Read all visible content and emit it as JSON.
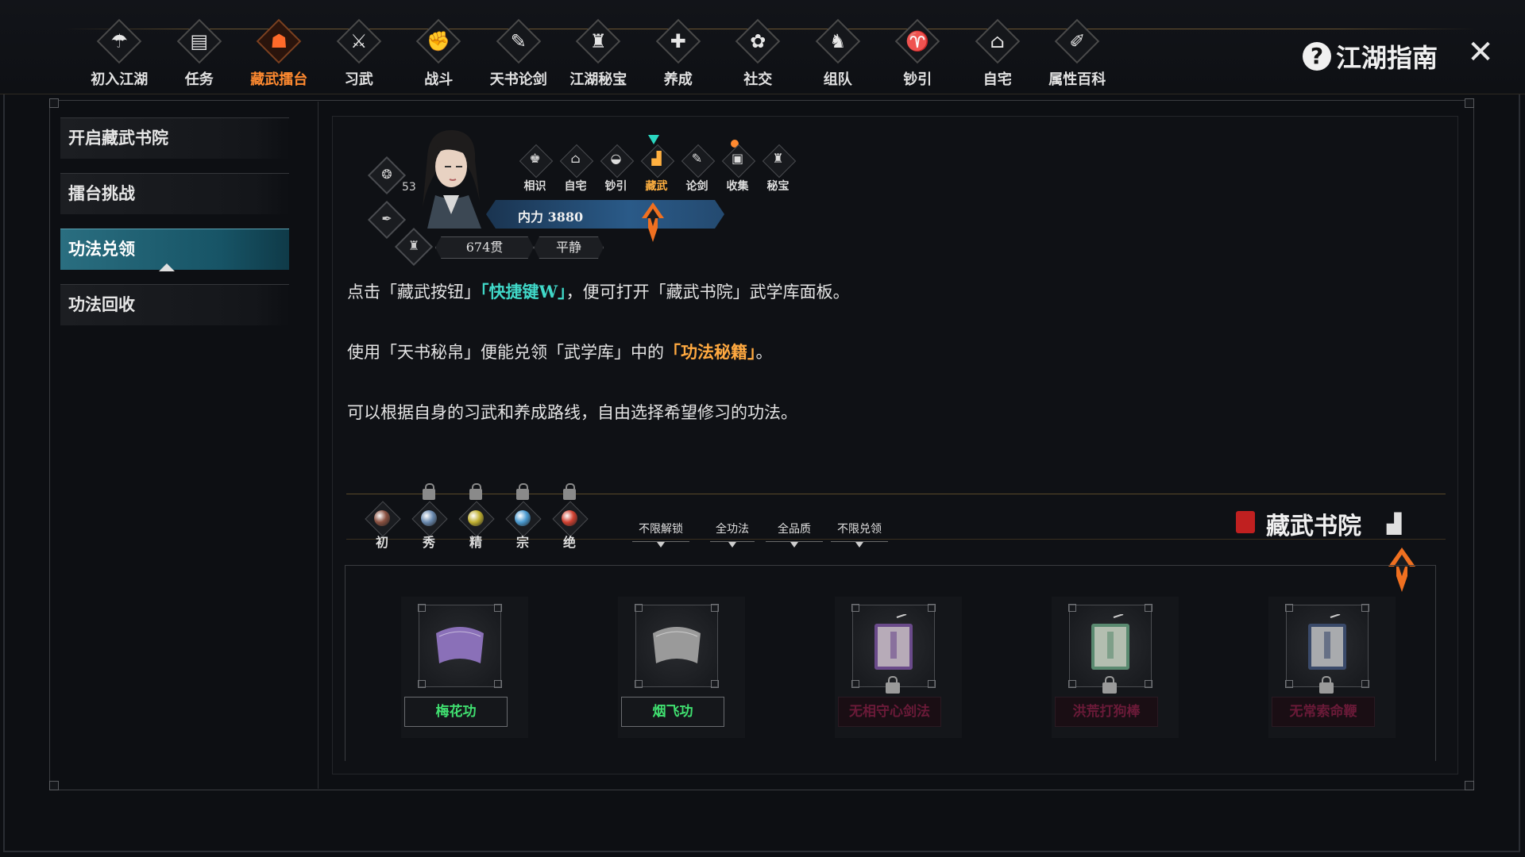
{
  "nav": {
    "items": [
      {
        "label": "初入江湖",
        "icon": "umbrella-icon",
        "glyph": "☂"
      },
      {
        "label": "任务",
        "icon": "scroll-icon",
        "glyph": "▤"
      },
      {
        "label": "藏武擂台",
        "icon": "arena-icon",
        "glyph": "☗"
      },
      {
        "label": "习武",
        "icon": "sword-icon",
        "glyph": "⚔"
      },
      {
        "label": "战斗",
        "icon": "fist-icon",
        "glyph": "✊"
      },
      {
        "label": "天书论剑",
        "icon": "book-sword-icon",
        "glyph": "✎"
      },
      {
        "label": "江湖秘宝",
        "icon": "treasure-bag-icon",
        "glyph": "♜"
      },
      {
        "label": "养成",
        "icon": "growth-icon",
        "glyph": "✚"
      },
      {
        "label": "社交",
        "icon": "fan-icon",
        "glyph": "✿"
      },
      {
        "label": "组队",
        "icon": "team-icon",
        "glyph": "♞"
      },
      {
        "label": "钞引",
        "icon": "ticket-icon",
        "glyph": "♈"
      },
      {
        "label": "自宅",
        "icon": "house-icon",
        "glyph": "⌂"
      },
      {
        "label": "属性百科",
        "icon": "encyclopedia-icon",
        "glyph": "✐"
      }
    ],
    "active_index": 2,
    "guide_title": "江湖指南",
    "help_glyph": "?",
    "close_glyph": "✕"
  },
  "sidebar": {
    "items": [
      {
        "label": "开启藏武书院"
      },
      {
        "label": "擂台挑战"
      },
      {
        "label": "功法兑领"
      },
      {
        "label": "功法回收"
      }
    ],
    "active_index": 2
  },
  "character": {
    "level": "53",
    "power": "内力 3880",
    "money": "674贯",
    "mood": "平静",
    "mini_icons": [
      {
        "label": "相识",
        "glyph": "♚"
      },
      {
        "label": "自宅",
        "glyph": "⌂"
      },
      {
        "label": "钞引",
        "glyph": "◒"
      },
      {
        "label": "藏武",
        "glyph": "▟"
      },
      {
        "label": "论剑",
        "glyph": "✎"
      },
      {
        "label": "收集",
        "glyph": "▣"
      },
      {
        "label": "秘宝",
        "glyph": "♜"
      }
    ],
    "mini_active_index": 3
  },
  "guide_text": {
    "line1": {
      "a": "点击「藏武按钮」",
      "b": "「快捷键W」",
      "c": "，便可打开「藏武书院」武学库面板。"
    },
    "line2": {
      "a": "使用「天书秘帛」便能兑领「武学库」中的",
      "b": "「功法秘籍」",
      "c": "。"
    },
    "line3": "可以根据自身的习武和养成路线，自由选择希望修习的功法。"
  },
  "library": {
    "title": "藏武书院",
    "grades": [
      {
        "label": "初",
        "color": "#8a5040",
        "locked": false
      },
      {
        "label": "秀",
        "color": "#6a8ab0",
        "locked": true
      },
      {
        "label": "精",
        "color": "#c0b030",
        "locked": true
      },
      {
        "label": "宗",
        "color": "#4a9ad0",
        "locked": true
      },
      {
        "label": "绝",
        "color": "#d04030",
        "locked": true
      }
    ],
    "filters": [
      "不限解锁",
      "全功法",
      "全品质",
      "不限兑领"
    ],
    "items": [
      {
        "label": "梅花功",
        "locked": false,
        "color": "#8a70b8"
      },
      {
        "label": "烟飞功",
        "locked": false,
        "color": "#9a9a9a"
      },
      {
        "label": "无相守心剑法",
        "locked": true,
        "color": "#6a4a8a"
      },
      {
        "label": "洪荒打狗棒",
        "locked": true,
        "color": "#5a8a70"
      },
      {
        "label": "无常索命鞭",
        "locked": true,
        "color": "#3a4a6a"
      }
    ]
  },
  "colors": {
    "accent_orange": "#ff8a30",
    "highlight_teal": "#40d8c8",
    "highlight_orange": "#ffa940",
    "active_tab": "#175466",
    "unlocked_label": "#40e070",
    "locked_label": "#6a1a38"
  }
}
